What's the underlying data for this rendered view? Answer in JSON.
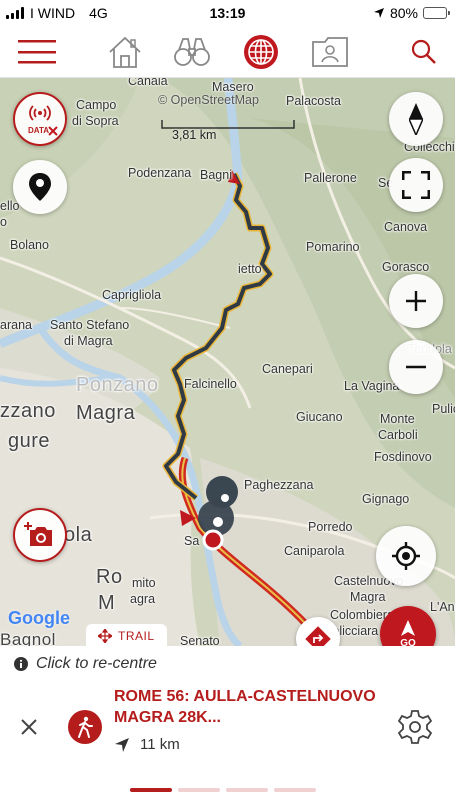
{
  "status_bar": {
    "carrier": "I WIND",
    "network": "4G",
    "time": "13:19",
    "battery": "80%",
    "battery_level": 0.8
  },
  "nav": {
    "items": [
      "menu-icon",
      "home-icon",
      "binoculars-icon",
      "globe-icon",
      "profile-card-icon",
      "search-icon"
    ],
    "accent": "#b51c1c"
  },
  "map": {
    "attribution": "© OpenStreetMap",
    "scale": "3,81 km",
    "google": "Google",
    "data_label": "DATA",
    "places": [
      {
        "name": "Canala"
      },
      {
        "name": "Masero"
      },
      {
        "name": "Palacosta"
      },
      {
        "name": "Campo"
      },
      {
        "name": "di Sopra"
      },
      {
        "name": "Collecchi"
      },
      {
        "name": "Podenzana"
      },
      {
        "name": "Bagni"
      },
      {
        "name": "Pallerone"
      },
      {
        "name": "Se"
      },
      {
        "name": "ello"
      },
      {
        "name": "o"
      },
      {
        "name": "Canova"
      },
      {
        "name": "Bolano"
      },
      {
        "name": "Pomarino"
      },
      {
        "name": "Gorasco"
      },
      {
        "name": "Caprigliola"
      },
      {
        "name": "arana"
      },
      {
        "name": "Santo Stefano"
      },
      {
        "name": "di Magra"
      },
      {
        "name": "Tendola"
      },
      {
        "name": "Canepari"
      },
      {
        "name": "Falcinello"
      },
      {
        "name": "La Vagina"
      },
      {
        "name": "Giucano"
      },
      {
        "name": "Monte"
      },
      {
        "name": "Carboli"
      },
      {
        "name": "Pulic"
      },
      {
        "name": "Fosdinovo"
      },
      {
        "name": "Paghezzana"
      },
      {
        "name": "Gignago"
      },
      {
        "name": "Porredo"
      },
      {
        "name": "Caniparola"
      },
      {
        "name": "Castelnuovo"
      },
      {
        "name": "Magra"
      },
      {
        "name": "L'Ann"
      },
      {
        "name": "Colombiera"
      },
      {
        "name": "Molicciara"
      },
      {
        "name": "mito"
      },
      {
        "name": "agra"
      },
      {
        "name": "Senato"
      },
      {
        "name": "Sa"
      },
      {
        "name": "zzano"
      },
      {
        "name": "gure"
      },
      {
        "name": "Ponzano"
      },
      {
        "name": "Magra"
      },
      {
        "name": "ola"
      },
      {
        "name": "Ro"
      },
      {
        "name": "M"
      },
      {
        "name": "Bagnol"
      },
      {
        "name": "ietto"
      }
    ]
  },
  "trail_chip": "TRAIL",
  "go_button": "GO",
  "recentre": "Click to re-centre",
  "route": {
    "title": "ROME 56: AULLA-CASTELNUOVO MAGRA 28K...",
    "distance": "11 km"
  },
  "pager": {
    "count": 5,
    "active": 0
  }
}
